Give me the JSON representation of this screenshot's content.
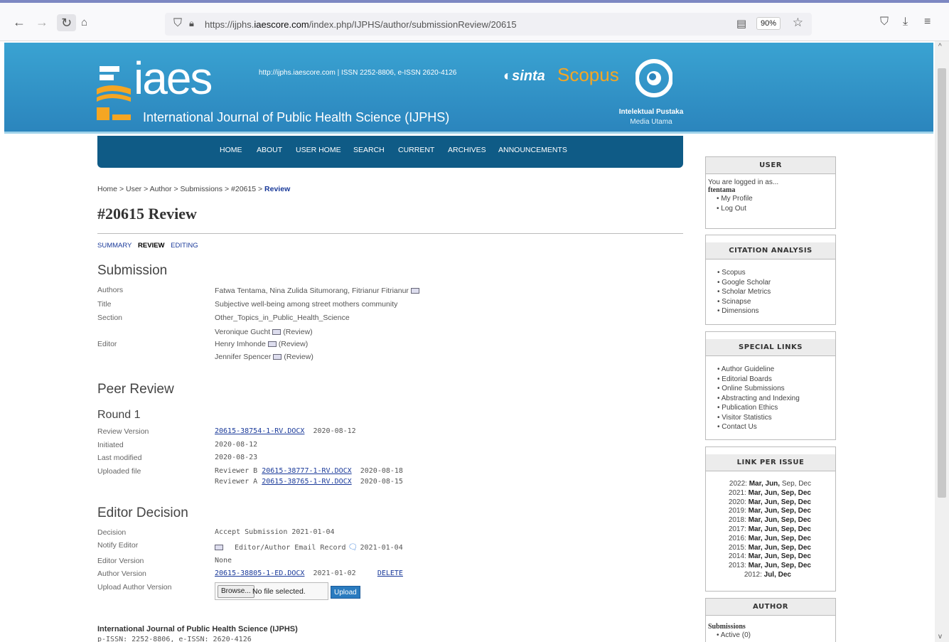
{
  "browser": {
    "url_prefix": "https://ijphs.",
    "url_domain": "iaescore.com",
    "url_path": "/index.php/IJPHS/author/submissionReview/20615",
    "zoom": "90%"
  },
  "header": {
    "logo_text": "iaes",
    "journal_name": "International Journal of Public Health Science (IJPHS)",
    "issn_line": "http://ijphs.iaescore.com  |  ISSN 2252-8806, e-ISSN 2620-4126",
    "sinta": "sinta",
    "scopus": "Scopus",
    "publisher_name": "Intelektual Pustaka",
    "publisher_sub": "Media Utama"
  },
  "nav": {
    "items": [
      "HOME",
      "ABOUT",
      "USER HOME",
      "SEARCH",
      "CURRENT",
      "ARCHIVES",
      "ANNOUNCEMENTS"
    ]
  },
  "breadcrumb": {
    "home": "Home",
    "user": "User",
    "author": "Author",
    "submissions": "Submissions",
    "id": "#20615",
    "current": "Review",
    "sep": ">"
  },
  "page": {
    "title": "#20615 Review",
    "tabs": [
      "SUMMARY",
      "REVIEW",
      "EDITING"
    ]
  },
  "submission": {
    "heading": "Submission",
    "authors_label": "Authors",
    "authors": "Fatwa Tentama, Nina Zulida Situmorang, Fitrianur Fitrianur",
    "title_label": "Title",
    "title": "Subjective well-being among street mothers community",
    "section_label": "Section",
    "section": "Other_Topics_in_Public_Health_Science",
    "editor_label": "Editor",
    "editors": [
      {
        "name": "Veronique Gucht",
        "role": "(Review)"
      },
      {
        "name": "Henry Imhonde",
        "role": "(Review)"
      },
      {
        "name": "Jennifer Spencer",
        "role": "(Review)"
      }
    ]
  },
  "peer_review": {
    "heading": "Peer Review",
    "round": "Round 1",
    "review_version_label": "Review Version",
    "review_version_file": "20615-38754-1-RV.DOCX",
    "review_version_date": "2020-08-12",
    "initiated_label": "Initiated",
    "initiated": "2020-08-12",
    "last_modified_label": "Last modified",
    "last_modified": "2020-08-23",
    "uploaded_file_label": "Uploaded file",
    "uploads": [
      {
        "reviewer": "Reviewer B",
        "file": "20615-38777-1-RV.DOCX",
        "date": "2020-08-18"
      },
      {
        "reviewer": "Reviewer A",
        "file": "20615-38765-1-RV.DOCX",
        "date": "2020-08-15"
      }
    ]
  },
  "editor_decision": {
    "heading": "Editor Decision",
    "decision_label": "Decision",
    "decision": "Accept Submission 2021-01-04",
    "notify_label": "Notify Editor",
    "notify_record": "Editor/Author Email Record",
    "notify_date": "2021-01-04",
    "editor_version_label": "Editor Version",
    "editor_version": "None",
    "author_version_label": "Author Version",
    "author_version_file": "20615-38805-1-ED.DOCX",
    "author_version_date": "2021-01-02",
    "delete_label": "DELETE",
    "upload_author_label": "Upload Author Version",
    "browse_label": "Browse...",
    "no_file": "No file selected.",
    "upload_label": "Upload"
  },
  "footer": {
    "title": "International Journal of Public Health Science (IJPHS)",
    "issn": "p-ISSN: 2252-8806, e-ISSN: 2620-4126"
  },
  "sidebar": {
    "user": {
      "heading": "USER",
      "logged_in": "You are logged in as...",
      "username": "ftentama",
      "links": [
        "My Profile",
        "Log Out"
      ]
    },
    "citation": {
      "heading": "CITATION ANALYSIS",
      "links": [
        "Scopus",
        "Google Scholar",
        "Scholar Metrics",
        "Scinapse",
        "Dimensions"
      ]
    },
    "special": {
      "heading": "SPECIAL LINKS",
      "links": [
        "Author Guideline",
        "Editorial Boards",
        "Online Submissions",
        "Abstracting and Indexing",
        "Publication Ethics",
        "Visitor Statistics",
        "Contact Us"
      ]
    },
    "issues": {
      "heading": "LINK PER ISSUE",
      "rows": [
        {
          "year": "2022:",
          "issues": "Mar, Jun,",
          "rest": " Sep, Dec"
        },
        {
          "year": "2021:",
          "issues": "Mar, Jun, Sep, Dec",
          "rest": ""
        },
        {
          "year": "2020:",
          "issues": "Mar, Jun, Sep, Dec",
          "rest": ""
        },
        {
          "year": "2019:",
          "issues": "Mar, Jun, Sep, Dec",
          "rest": ""
        },
        {
          "year": "2018:",
          "issues": "Mar, Jun, Sep, Dec",
          "rest": ""
        },
        {
          "year": "2017:",
          "issues": "Mar, Jun, Sep, Dec",
          "rest": ""
        },
        {
          "year": "2016:",
          "issues": "Mar, Jun, Sep, Dec",
          "rest": ""
        },
        {
          "year": "2015:",
          "issues": "Mar, Jun, Sep, Dec",
          "rest": ""
        },
        {
          "year": "2014:",
          "issues": "Mar, Jun, Sep, Dec",
          "rest": ""
        },
        {
          "year": "2013:",
          "issues": "Mar, Jun, Sep, Dec",
          "rest": ""
        },
        {
          "year": "2012:",
          "issues": "Jul, Dec",
          "rest": ""
        }
      ]
    },
    "author": {
      "heading": "AUTHOR",
      "submissions": "Submissions",
      "active": "Active (0)"
    }
  }
}
